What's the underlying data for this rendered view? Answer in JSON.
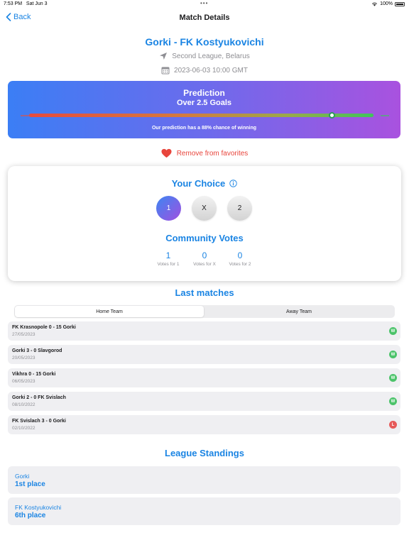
{
  "status_bar": {
    "time": "7:53 PM",
    "date": "Sat Jun 3",
    "dots": "•••",
    "battery": "100%"
  },
  "nav": {
    "back_label": "Back",
    "title": "Match Details"
  },
  "match": {
    "title": "Gorki - FK Kostyukovichi",
    "league": "Second League, Belarus",
    "datetime": "2023-06-03 10:00 GMT"
  },
  "prediction": {
    "title": "Prediction",
    "value": "Over 2.5 Goals",
    "chance_percent": 88,
    "note": "Our prediction has a 88% chance of winning"
  },
  "favorites": {
    "label": "Remove from favorites"
  },
  "choice": {
    "title": "Your Choice",
    "options": [
      "1",
      "X",
      "2"
    ],
    "selected": "1"
  },
  "community": {
    "title": "Community Votes",
    "votes": [
      {
        "count": "1",
        "label": "Votes for 1"
      },
      {
        "count": "0",
        "label": "Votes for X"
      },
      {
        "count": "0",
        "label": "Votes for 2"
      }
    ]
  },
  "last_matches": {
    "title": "Last matches",
    "tabs": [
      "Home Team",
      "Away Team"
    ],
    "selected_tab": "Home Team",
    "items": [
      {
        "name": "FK Krasnopole 0 - 15 Gorki",
        "date": "27/05/2023",
        "result": "W"
      },
      {
        "name": "Gorki 3 - 0 Slavgorod",
        "date": "20/05/2023",
        "result": "W"
      },
      {
        "name": "Vikhra 0 - 15 Gorki",
        "date": "06/05/2023",
        "result": "W"
      },
      {
        "name": "Gorki 2 - 0 FK Svislach",
        "date": "08/10/2022",
        "result": "W"
      },
      {
        "name": "FK Svislach 3 - 0 Gorki",
        "date": "02/10/2022",
        "result": "L"
      }
    ]
  },
  "standings": {
    "title": "League Standings",
    "items": [
      {
        "team": "Gorki",
        "place": "1st place"
      },
      {
        "team": "FK Kostyukovichi",
        "place": "6th place"
      }
    ]
  },
  "colors": {
    "accent": "#1a84e3",
    "favorite": "#e8453c",
    "win": "#4cc36a",
    "loss": "#e65a5a"
  }
}
